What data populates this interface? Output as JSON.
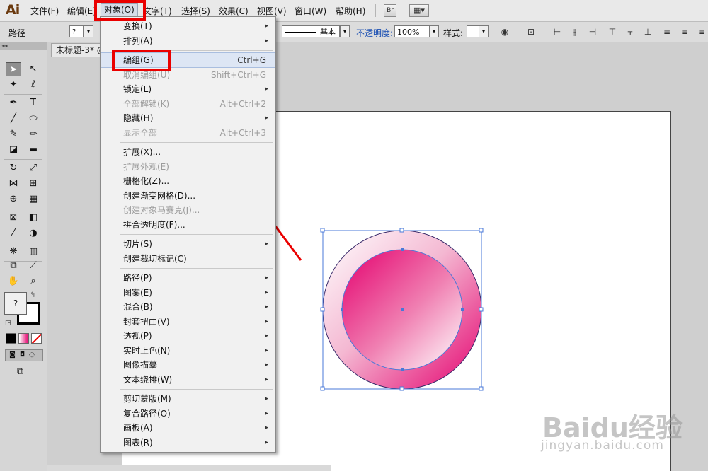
{
  "app": {
    "logo": "Ai"
  },
  "menubar": {
    "items": [
      {
        "label": "文件(F)"
      },
      {
        "label": "编辑(E)"
      },
      {
        "label": "对象(O)"
      },
      {
        "label": "文字(T)"
      },
      {
        "label": "选择(S)"
      },
      {
        "label": "效果(C)"
      },
      {
        "label": "视图(V)"
      },
      {
        "label": "窗口(W)"
      },
      {
        "label": "帮助(H)"
      }
    ],
    "bridge_label": "Br",
    "workspace_label": "▦▾"
  },
  "control_bar": {
    "selection_label": "路径",
    "stroke_profile": "基本",
    "opacity_label": "不透明度:",
    "opacity_value": "100%",
    "style_label": "样式:"
  },
  "document": {
    "tab_title": "未标题-3* @"
  },
  "object_menu": {
    "groups": [
      [
        {
          "label": "变换(T)",
          "shortcut": "",
          "submenu": true,
          "disabled": false
        },
        {
          "label": "排列(A)",
          "shortcut": "",
          "submenu": true,
          "disabled": false
        }
      ],
      [
        {
          "label": "编组(G)",
          "shortcut": "Ctrl+G",
          "submenu": false,
          "disabled": false,
          "highlighted": true
        },
        {
          "label": "取消编组(U)",
          "shortcut": "Shift+Ctrl+G",
          "submenu": false,
          "disabled": true
        },
        {
          "label": "锁定(L)",
          "shortcut": "",
          "submenu": true,
          "disabled": false
        },
        {
          "label": "全部解锁(K)",
          "shortcut": "Alt+Ctrl+2",
          "submenu": false,
          "disabled": true
        },
        {
          "label": "隐藏(H)",
          "shortcut": "",
          "submenu": true,
          "disabled": false
        },
        {
          "label": "显示全部",
          "shortcut": "Alt+Ctrl+3",
          "submenu": false,
          "disabled": true
        }
      ],
      [
        {
          "label": "扩展(X)...",
          "shortcut": "",
          "submenu": false,
          "disabled": false
        },
        {
          "label": "扩展外观(E)",
          "shortcut": "",
          "submenu": false,
          "disabled": true
        },
        {
          "label": "栅格化(Z)...",
          "shortcut": "",
          "submenu": false,
          "disabled": false
        },
        {
          "label": "创建渐变网格(D)...",
          "shortcut": "",
          "submenu": false,
          "disabled": false
        },
        {
          "label": "创建对象马赛克(J)...",
          "shortcut": "",
          "submenu": false,
          "disabled": true
        },
        {
          "label": "拼合透明度(F)...",
          "shortcut": "",
          "submenu": false,
          "disabled": false
        }
      ],
      [
        {
          "label": "切片(S)",
          "shortcut": "",
          "submenu": true,
          "disabled": false
        },
        {
          "label": "创建裁切标记(C)",
          "shortcut": "",
          "submenu": false,
          "disabled": false
        }
      ],
      [
        {
          "label": "路径(P)",
          "shortcut": "",
          "submenu": true,
          "disabled": false
        },
        {
          "label": "图案(E)",
          "shortcut": "",
          "submenu": true,
          "disabled": false
        },
        {
          "label": "混合(B)",
          "shortcut": "",
          "submenu": true,
          "disabled": false
        },
        {
          "label": "封套扭曲(V)",
          "shortcut": "",
          "submenu": true,
          "disabled": false
        },
        {
          "label": "透视(P)",
          "shortcut": "",
          "submenu": true,
          "disabled": false
        },
        {
          "label": "实时上色(N)",
          "shortcut": "",
          "submenu": true,
          "disabled": false
        },
        {
          "label": "图像描摹",
          "shortcut": "",
          "submenu": true,
          "disabled": false
        },
        {
          "label": "文本绕排(W)",
          "shortcut": "",
          "submenu": true,
          "disabled": false
        }
      ],
      [
        {
          "label": "剪切蒙版(M)",
          "shortcut": "",
          "submenu": true,
          "disabled": false
        },
        {
          "label": "复合路径(O)",
          "shortcut": "",
          "submenu": true,
          "disabled": false
        },
        {
          "label": "画板(A)",
          "shortcut": "",
          "submenu": true,
          "disabled": false
        },
        {
          "label": "图表(R)",
          "shortcut": "",
          "submenu": true,
          "disabled": false
        }
      ]
    ]
  },
  "watermark": {
    "line1": "Baidu经验",
    "line2": "jingyan.baidu.com"
  },
  "colors": {
    "annotation_red": "#ea0000",
    "magenta": "#e4006e",
    "selection_blue": "#4a78d8",
    "menu_highlight": "#dde6f4"
  },
  "icons": {
    "submenu": "▸",
    "dropdown": "▾"
  }
}
